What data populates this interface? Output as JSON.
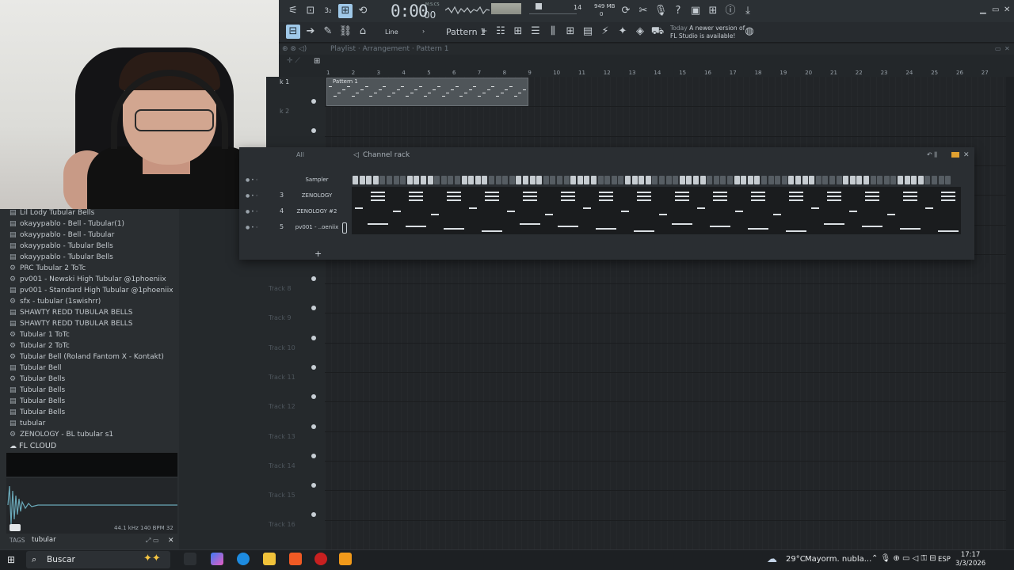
{
  "toolbar": {
    "time": "0:00",
    "time_sub": "00",
    "time_unit": "M:S:CS",
    "cpu": "14",
    "memory": "949 MB",
    "voices": "0",
    "line_mode": "Line",
    "pattern": "Pattern 1",
    "news_date": "Today",
    "news_text1": "A newer version of",
    "news_text2": "FL Studio is available!"
  },
  "playlist": {
    "breadcrumb": "Playlist · Arrangement · Pattern 1",
    "clip_label": "Pattern 1",
    "track1_label": "k 1",
    "track2_label": "k 2",
    "ruler": [
      "1",
      "2",
      "3",
      "4",
      "5",
      "6",
      "7",
      "8",
      "9",
      "10",
      "11",
      "12",
      "13",
      "14",
      "15",
      "16",
      "17",
      "18",
      "19",
      "20",
      "21",
      "22",
      "23",
      "24",
      "25",
      "26",
      "27"
    ],
    "tracks": [
      "Track 8",
      "Track 9",
      "Track 10",
      "Track 11",
      "Track 12",
      "Track 13",
      "Track 14",
      "Track 15",
      "Track 16"
    ]
  },
  "channel_rack": {
    "title": "Channel rack",
    "filter": "All",
    "channels": [
      {
        "num": "",
        "name": "Sampler"
      },
      {
        "num": "3",
        "name": "ZENOLOGY"
      },
      {
        "num": "4",
        "name": "ZENOLOGY #2"
      },
      {
        "num": "5",
        "name": "pv001 - ..oeniix"
      }
    ]
  },
  "browser": {
    "items": [
      {
        "icon": "doc",
        "label": "Lil Lody Tubular Bells"
      },
      {
        "icon": "doc",
        "label": "okayypablo - Bell - Tubular(1)"
      },
      {
        "icon": "doc",
        "label": "okayypablo - Bell - Tubular"
      },
      {
        "icon": "doc",
        "label": "okayypablo - Tubular Bells"
      },
      {
        "icon": "doc",
        "label": "okayypablo - Tubular Bells"
      },
      {
        "icon": "gear",
        "label": "PRC Tubular 2 ToTc"
      },
      {
        "icon": "gear",
        "label": "pv001 - Newski High Tubular @1phoeniix"
      },
      {
        "icon": "doc",
        "label": "pv001 - Standard High Tubular @1phoeniix"
      },
      {
        "icon": "gear",
        "label": "sfx - tubular (1swishrr)"
      },
      {
        "icon": "doc",
        "label": "SHAWTY REDD TUBULAR BELLS"
      },
      {
        "icon": "doc",
        "label": "SHAWTY REDD TUBULAR BELLS"
      },
      {
        "icon": "gear",
        "label": "Tubular 1 ToTc"
      },
      {
        "icon": "gear",
        "label": "Tubular 2 ToTc"
      },
      {
        "icon": "gear",
        "label": "Tubular Bell (Roland Fantom X - Kontakt)"
      },
      {
        "icon": "doc",
        "label": "Tubular Bell"
      },
      {
        "icon": "gear",
        "label": "Tubular Bells"
      },
      {
        "icon": "doc",
        "label": "Tubular Bells"
      },
      {
        "icon": "doc",
        "label": "Tubular Bells"
      },
      {
        "icon": "doc",
        "label": "Tubular Bells"
      },
      {
        "icon": "doc",
        "label": "tubular"
      },
      {
        "icon": "gear",
        "label": "ZENOLOGY - BL tubular s1"
      }
    ],
    "cloud": "FL CLOUD",
    "sample_info": "44.1 kHz 140 BPM 32",
    "tags_label": "TAGS",
    "tags_value": "tubular"
  },
  "taskbar": {
    "search": "Buscar",
    "temperature": "29°C",
    "weather": "Mayorm. nubla...",
    "language": "ESP",
    "time": "17:17",
    "date": "3/3/2026"
  }
}
